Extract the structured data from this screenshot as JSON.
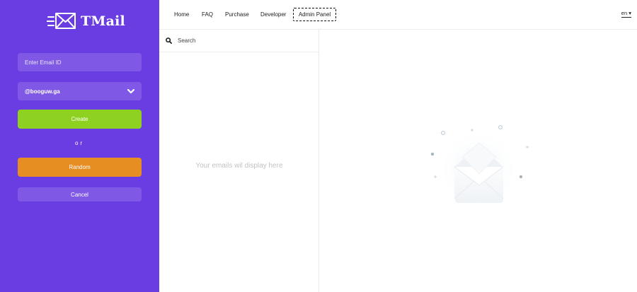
{
  "app": {
    "brand": "TMail"
  },
  "sidebar": {
    "email_placeholder": "Enter Email ID",
    "domain_selected": "@booguw.ga",
    "create_label": "Create",
    "or_label": "or",
    "random_label": "Random",
    "cancel_label": "Cancel"
  },
  "nav": {
    "items": [
      "Home",
      "FAQ",
      "Purchase",
      "Developer",
      "Admin Panel"
    ],
    "language": "en"
  },
  "inbox": {
    "search_placeholder": "Search",
    "empty_message": "Your emails wil display here"
  },
  "colors": {
    "sidebar_bg": "#6a3de2",
    "create_button": "#8fd120",
    "random_button": "#e78e22"
  },
  "icons": {
    "logo": "flying-envelope-icon",
    "dropdown": "chevron-down-icon",
    "search": "search-icon",
    "empty_state": "open-envelope-icon"
  }
}
